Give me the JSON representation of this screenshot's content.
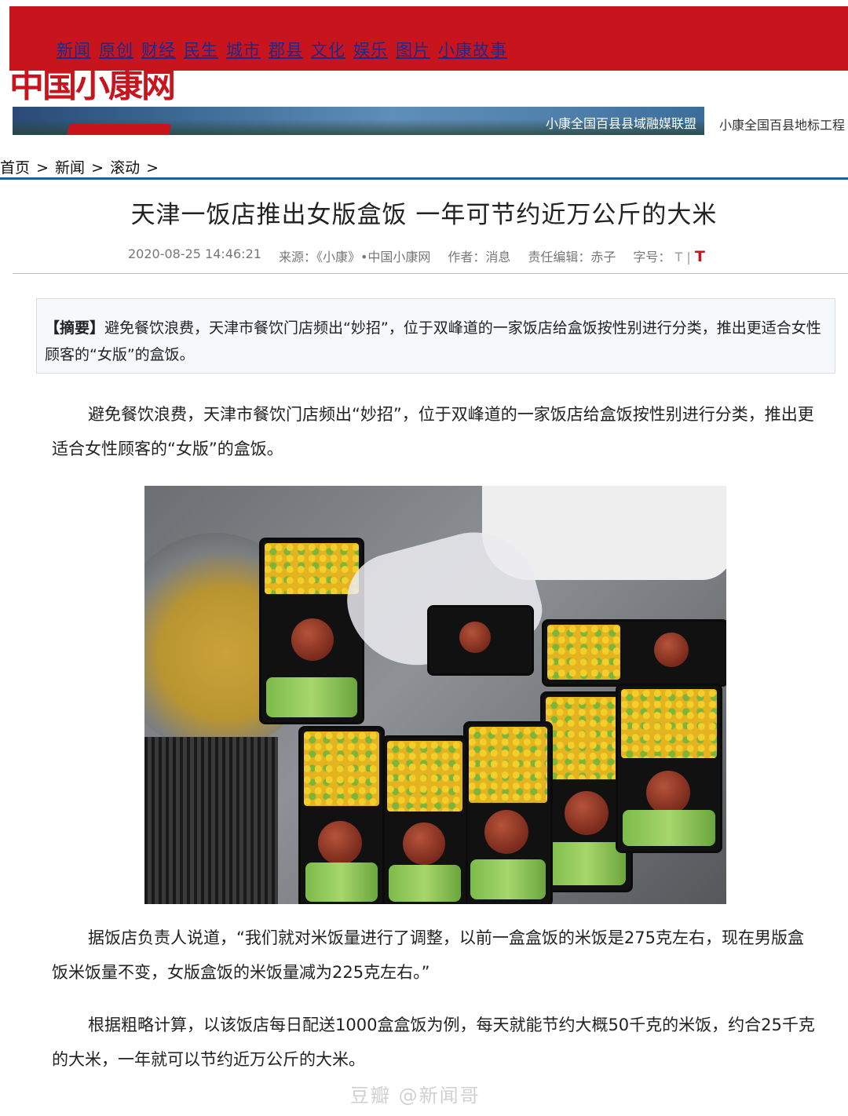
{
  "nav": {
    "items": [
      "新闻",
      "原创",
      "财经",
      "民生",
      "城市",
      "郡县",
      "文化",
      "娱乐",
      "图片",
      "小康故事"
    ]
  },
  "site": {
    "logo_text": "中国小康网",
    "banner_text": "小康全国百县县域融媒联盟",
    "banner_right_text": "小康全国百县地标工程"
  },
  "breadcrumb": {
    "items": [
      "首页",
      "新闻",
      "滚动"
    ],
    "separator": ">"
  },
  "article": {
    "title": "天津一饭店推出女版盒饭 一年可节约近万公斤的大米",
    "datetime": "2020-08-25 14:46:21",
    "source": "来源：《小康》•中国小康网",
    "author": "作者：消息",
    "editor": "责任编辑：赤子",
    "font_size_label": "字号：",
    "font_small": "T",
    "font_sep": "|",
    "font_large": "T",
    "summary_label": "【摘要】",
    "summary_text": "避免餐饮浪费，天津市餐饮门店频出“妙招”，位于双峰道的一家饭店给盒饭按性别进行分类，推出更适合女性顾客的“女版”的盒饭。",
    "paragraphs": [
      "避免餐饮浪费，天津市餐饮门店频出“妙招”，位于双峰道的一家饭店给盒饭按性别进行分类，推出更适合女性顾客的“女版”的盒饭。",
      "据饭店负责人说道，“我们就对米饭量进行了调整，以前一盒盒饭的米饭是275克左右，现在男版盒饭米饭量不变，女版盒饭的米饭量减为225克左右。”",
      "根据粗略计算，以该饭店每日配送1000盒盒饭为例，每天就能节约大概50千克的米饭，约合25千克的大米，一年就可以节约近万公斤的大米。"
    ]
  },
  "watermark": "豆瓣 @新闻哥",
  "colors": {
    "brand_red": "#c8141d",
    "nav_link": "#1a2b8f",
    "rule_blue": "#1c5fa8"
  }
}
